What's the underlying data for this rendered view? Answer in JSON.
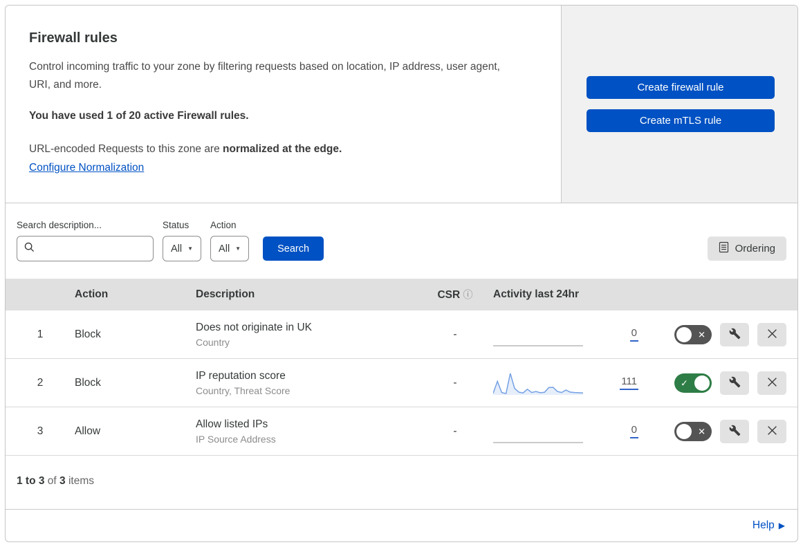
{
  "header": {
    "title": "Firewall rules",
    "description": "Control incoming traffic to your zone by filtering requests based on location, IP address, user agent, URI, and more.",
    "usage": "You have used 1 of 20 active Firewall rules.",
    "normalization_text": "URL-encoded Requests to this zone are ",
    "normalization_bold": "normalized at the edge.",
    "normalization_link": "Configure Normalization",
    "create_firewall_rule": "Create firewall rule",
    "create_mtls_rule": "Create mTLS rule"
  },
  "filters": {
    "search_label": "Search description...",
    "search_value": "",
    "status_label": "Status",
    "status_value": "All",
    "action_label": "Action",
    "action_value": "All",
    "search_button": "Search",
    "ordering_button": "Ordering"
  },
  "table": {
    "columns": [
      "Action",
      "Description",
      "CSR",
      "Activity last 24hr"
    ],
    "rows": [
      {
        "priority": "1",
        "action": "Block",
        "description": "Does not originate in UK",
        "criteria": "Country",
        "csr": "-",
        "activity_count": "0",
        "enabled": false,
        "sparkline": []
      },
      {
        "priority": "2",
        "action": "Block",
        "description": "IP reputation score",
        "criteria": "Country, Threat Score",
        "csr": "-",
        "activity_count": "111",
        "enabled": true,
        "sparkline": [
          4,
          62,
          8,
          3,
          100,
          28,
          10,
          6,
          24,
          8,
          13,
          7,
          9,
          32,
          33,
          13,
          8,
          20,
          10,
          8,
          7,
          6
        ]
      },
      {
        "priority": "3",
        "action": "Allow",
        "description": "Allow listed IPs",
        "criteria": "IP Source Address",
        "csr": "-",
        "activity_count": "0",
        "enabled": false,
        "sparkline": []
      }
    ],
    "summary": {
      "range": "1 to 3",
      "of": "of",
      "total": "3",
      "items": "items"
    }
  },
  "footer": {
    "help_label": "Help"
  },
  "colors": {
    "accent_blue": "#0051c3",
    "toggle_on_green": "#2e7d46",
    "toggle_off_gray": "#545454",
    "sparkline_blue": "#74a0e4",
    "sparkline_fill": "rgba(116,160,228,0.18)",
    "flat_line_gray": "#b9b9b9",
    "table_header_gray": "#e0e0e0",
    "panel_gray": "#f1f1f1"
  },
  "icons": {
    "search": "magnifier",
    "csr_info": "ⓘ",
    "dropdown_caret": "▼",
    "ordering": "list-document",
    "wrench": "wrench",
    "close": "✕",
    "toggle_check": "✓",
    "toggle_cross": "✕",
    "help_arrow": "▶"
  }
}
